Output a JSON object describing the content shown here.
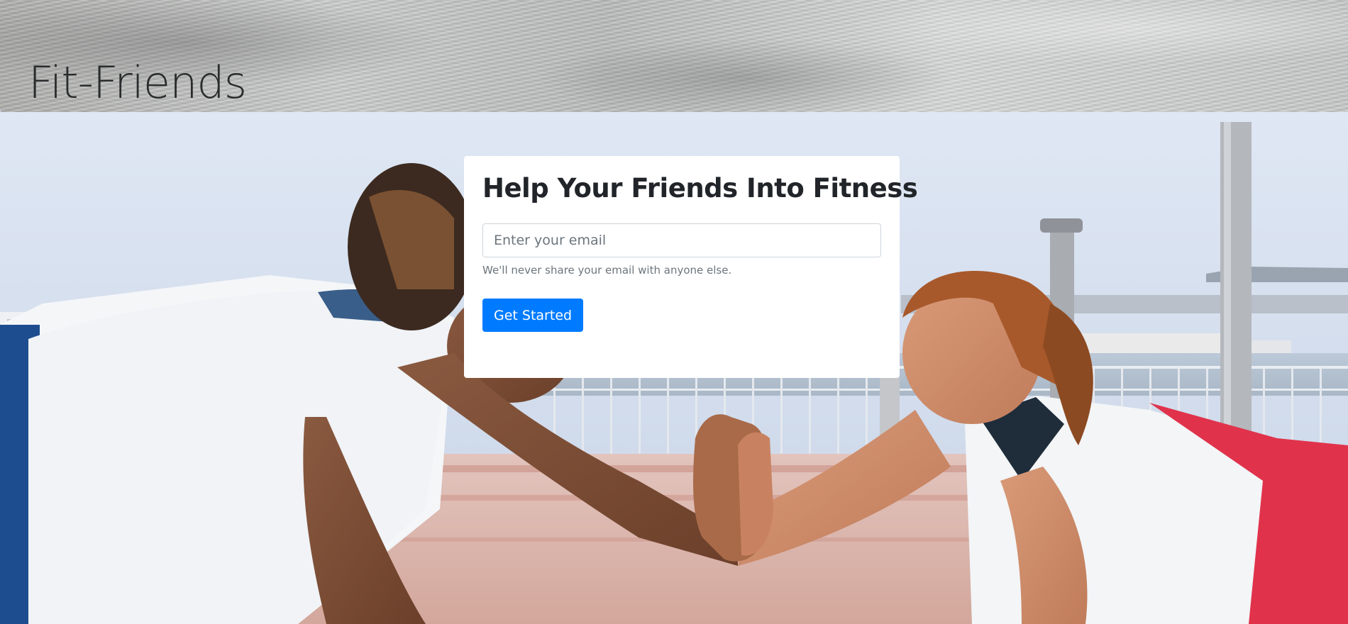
{
  "header": {
    "brand": "Fit-Friends"
  },
  "hero": {
    "image_subject": "two women high-fiving in plank position by the waterfront"
  },
  "signup": {
    "title": "Help Your Friends Into Fitness",
    "email_placeholder": "Enter your email",
    "email_value": "",
    "help_text": "We'll never share your email with anyone else.",
    "button_label": "Get Started"
  },
  "colors": {
    "primary": "#007bff",
    "title_text": "#212529",
    "muted_text": "#6c757d",
    "card_bg": "#ffffff"
  }
}
